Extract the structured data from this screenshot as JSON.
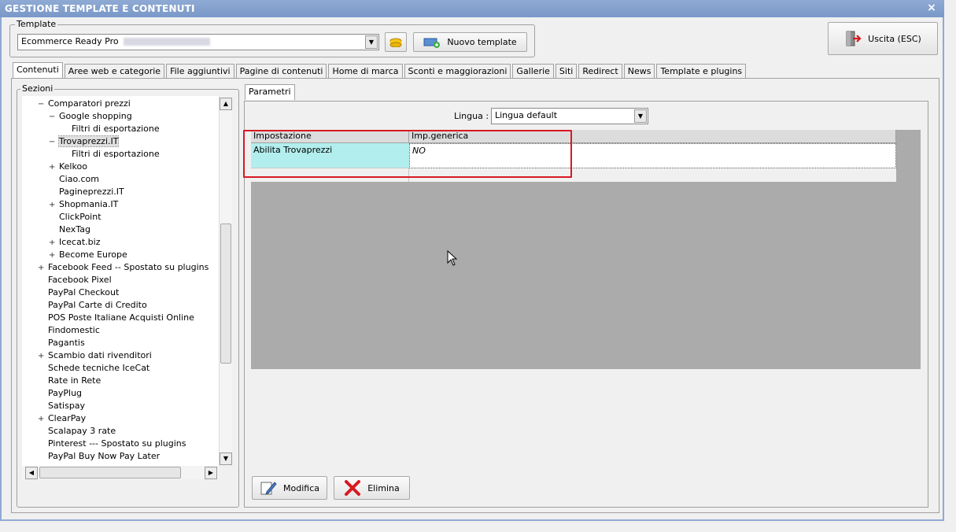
{
  "window": {
    "title": "GESTIONE TEMPLATE E CONTENUTI",
    "close_glyph": "×"
  },
  "template_group": {
    "label": "Template",
    "selected": "Ecommerce Ready Pro",
    "new_template_label": "Nuovo template"
  },
  "exit_button": {
    "label": "Uscita (ESC)"
  },
  "tabs": [
    "Contenuti",
    "Aree web e categorie",
    "File aggiuntivi",
    "Pagine di contenuti",
    "Home di marca",
    "Sconti e maggiorazioni",
    "Gallerie",
    "Siti",
    "Redirect",
    "News",
    "Template e plugins"
  ],
  "sections": {
    "label": "Sezioni",
    "items": [
      {
        "text": "Comparatori prezzi",
        "exp": "−",
        "level": 1
      },
      {
        "text": "Google shopping",
        "exp": "−",
        "level": 2
      },
      {
        "text": "Filtri di esportazione",
        "exp": "",
        "level": 3
      },
      {
        "text": "Trovaprezzi.IT",
        "exp": "−",
        "level": 2,
        "selected": true
      },
      {
        "text": "Filtri di esportazione",
        "exp": "",
        "level": 3
      },
      {
        "text": "Kelkoo",
        "exp": "+",
        "level": 2
      },
      {
        "text": "Ciao.com",
        "exp": "",
        "level": 2
      },
      {
        "text": "Pagineprezzi.IT",
        "exp": "",
        "level": 2
      },
      {
        "text": "Shopmania.IT",
        "exp": "+",
        "level": 2
      },
      {
        "text": "ClickPoint",
        "exp": "",
        "level": 2
      },
      {
        "text": "NexTag",
        "exp": "",
        "level": 2
      },
      {
        "text": "Icecat.biz",
        "exp": "+",
        "level": 2
      },
      {
        "text": "Become Europe",
        "exp": "+",
        "level": 2
      },
      {
        "text": "Facebook Feed -- Spostato su plugins",
        "exp": "+",
        "level": 1
      },
      {
        "text": "Facebook Pixel",
        "exp": "",
        "level": 1
      },
      {
        "text": "PayPal Checkout",
        "exp": "",
        "level": 1
      },
      {
        "text": "PayPal Carte di Credito",
        "exp": "",
        "level": 1
      },
      {
        "text": "POS Poste Italiane Acquisti Online",
        "exp": "",
        "level": 1
      },
      {
        "text": "Findomestic",
        "exp": "",
        "level": 1
      },
      {
        "text": "Pagantis",
        "exp": "",
        "level": 1
      },
      {
        "text": "Scambio dati rivenditori",
        "exp": "+",
        "level": 1
      },
      {
        "text": "Schede tecniche IceCat",
        "exp": "",
        "level": 1
      },
      {
        "text": "Rate in Rete",
        "exp": "",
        "level": 1
      },
      {
        "text": "PayPlug",
        "exp": "",
        "level": 1
      },
      {
        "text": "Satispay",
        "exp": "",
        "level": 1
      },
      {
        "text": "ClearPay",
        "exp": "+",
        "level": 1
      },
      {
        "text": "Scalapay 3 rate",
        "exp": "",
        "level": 1
      },
      {
        "text": "Pinterest --- Spostato su plugins",
        "exp": "",
        "level": 1
      },
      {
        "text": "PayPal Buy Now Pay Later",
        "exp": "",
        "level": 1
      }
    ]
  },
  "params": {
    "tab_label": "Parametri",
    "language_label": "Lingua :",
    "language_value": "Lingua default",
    "columns": [
      "Impostazione",
      "Imp.generica"
    ],
    "row": {
      "setting": "Abilita Trovaprezzi",
      "value": "NO"
    }
  },
  "actions": {
    "edit_label": "Modifica",
    "delete_label": "Elimina"
  },
  "colors": {
    "title_bar": "#8eaad4",
    "highlight": "#b2eeee",
    "annotation": "#d71920",
    "grid_empty": "#ababab"
  }
}
